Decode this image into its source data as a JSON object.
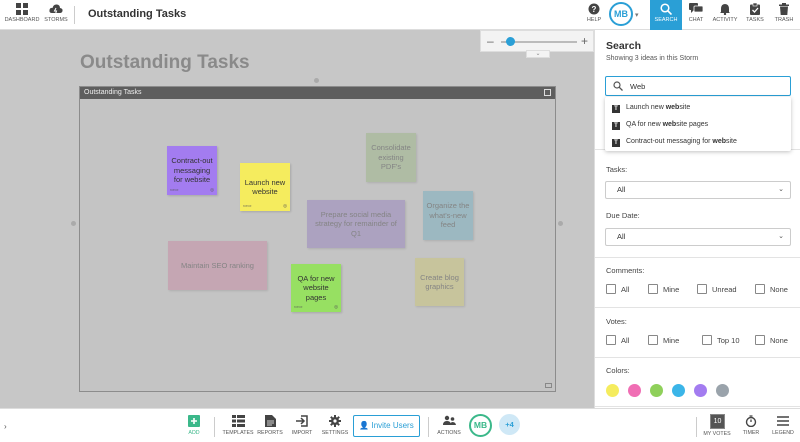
{
  "topbar": {
    "dashboard_label": "Dashboard",
    "storms_label": "Storms",
    "board_title": "Outstanding Tasks",
    "help_label": "Help",
    "avatar_initials": "MB",
    "search_label": "Search",
    "chat_label": "Chat",
    "activity_label": "Activity",
    "tasks_label": "Tasks",
    "trash_label": "Trash"
  },
  "canvas": {
    "title": "Outstanding Tasks",
    "section_title": "Outstanding Tasks",
    "zoom": {
      "minus": "–",
      "plus": "+",
      "level_fraction": 0.06
    },
    "notes": [
      {
        "text": "Contract-out messaging for website",
        "color": "#a37cf0",
        "dim": false
      },
      {
        "text": "Launch new website",
        "color": "#f5ec5e",
        "dim": false
      },
      {
        "text": "Consolidate existing PDF's",
        "color": "#a8ba9a",
        "dim": true
      },
      {
        "text": "Prepare social media strategy for remainder of Q1",
        "color": "#a497bf",
        "dim": true
      },
      {
        "text": "Organize the what's-new feed",
        "color": "#8fb5c0",
        "dim": true
      },
      {
        "text": "Maintain SEO ranking",
        "color": "#c69cae",
        "dim": true
      },
      {
        "text": "QA for new website pages",
        "color": "#97e062",
        "dim": false
      },
      {
        "text": "Create blog graphics",
        "color": "#c9c48f",
        "dim": true
      }
    ]
  },
  "panel": {
    "title": "Search",
    "subtitle": "Showing 3 ideas in this Storm",
    "search_value": "Web",
    "results": [
      {
        "before": "Launch new ",
        "match": "web",
        "after": "site"
      },
      {
        "before": "QA for new ",
        "match": "web",
        "after": "site pages"
      },
      {
        "before": "Contract-out messaging for ",
        "match": "web",
        "after": "site"
      }
    ],
    "tasks_label": "Tasks:",
    "tasks_value": "All",
    "due_label": "Due Date:",
    "due_value": "All",
    "comments_label": "Comments:",
    "comments_options": [
      "All",
      "Mine",
      "Unread",
      "None"
    ],
    "votes_label": "Votes:",
    "votes_options": [
      "All",
      "Mine",
      "Top 10",
      "None"
    ],
    "colors_label": "Colors:",
    "colors": [
      "#f5ec5e",
      "#f06eb4",
      "#8fd05a",
      "#3bb5e8",
      "#a37cf0",
      "#9aa3ab"
    ]
  },
  "bottombar": {
    "add_label": "Add",
    "templates_label": "Templates",
    "reports_label": "Reports",
    "import_label": "Import",
    "settings_label": "Settings",
    "invite_label": "Invite Users",
    "actions_label": "Actions",
    "avatar_initials": "MB",
    "more_users": "+4",
    "votes_count": "10",
    "my_votes_label": "My Votes",
    "timer_label": "Timer",
    "legend_label": "Legend"
  },
  "theme": {
    "accent": "#2a9fd6",
    "add_green": "#3bb88a"
  }
}
